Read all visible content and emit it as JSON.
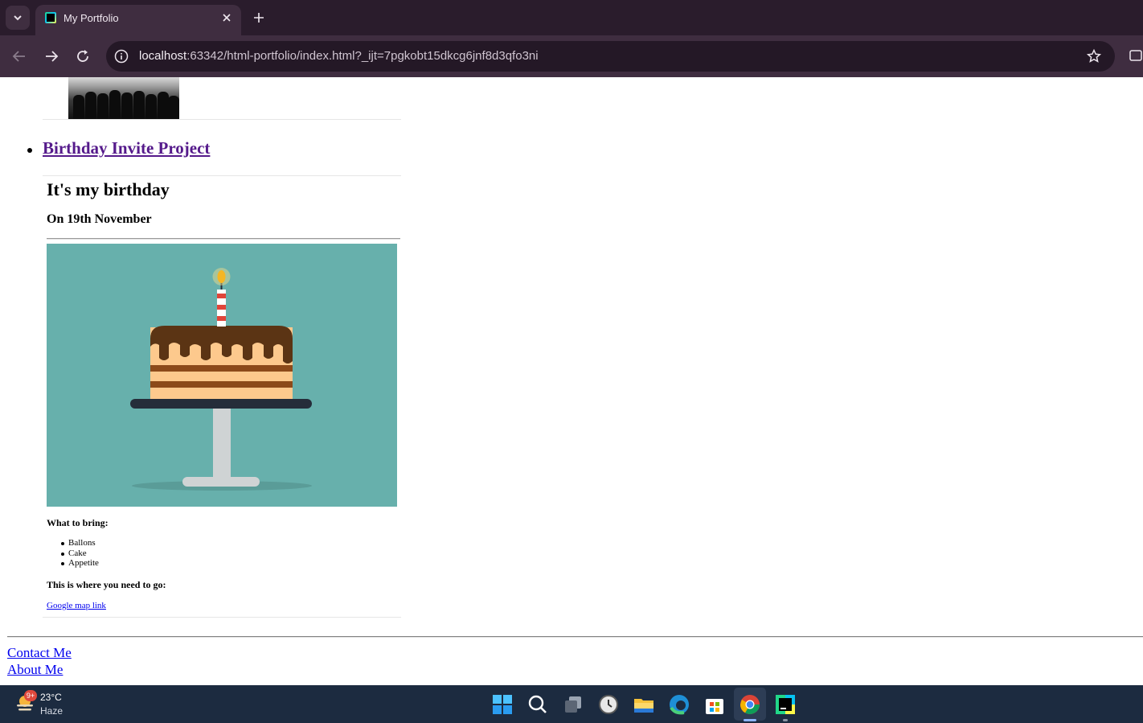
{
  "browser": {
    "tab_title": "My Portfolio",
    "url_host": "localhost",
    "url_rest": ":63342/html-portfolio/index.html?_ijt=7pgkobt15dkcg6jnf8d3qfo3ni",
    "icons": [
      "tab-list-icon",
      "webstorm-favicon-icon",
      "close-icon",
      "plus-icon",
      "back-icon",
      "forward-icon",
      "reload-icon",
      "info-icon",
      "star-icon",
      "extensions-icon"
    ]
  },
  "page": {
    "project_link": "Birthday Invite Project",
    "invite": {
      "heading": "It's my birthday",
      "date": "On 19th November",
      "bring_heading": "What to bring:",
      "items": [
        "Ballons",
        "Cake",
        "Appetite"
      ],
      "where_heading": "This is where you need to go:",
      "map_link": "Google map link"
    },
    "footer": {
      "contact": "Contact Me",
      "about": "About Me"
    }
  },
  "taskbar": {
    "weather_badge": "9+",
    "temperature": "23°C",
    "condition": "Haze",
    "icons": [
      "start-icon",
      "search-icon",
      "task-view-icon",
      "clock-app-icon",
      "file-explorer-icon",
      "edge-icon",
      "store-icon",
      "chrome-icon",
      "webstorm-icon"
    ]
  },
  "colors": {
    "tabbar_bg": "#2a1c2c",
    "toolbar_bg": "#3f2d40",
    "visited_link": "#551a8b",
    "link": "#0000ee",
    "cake_bg": "#67b0ac",
    "taskbar_bg": "#1c2b40"
  }
}
